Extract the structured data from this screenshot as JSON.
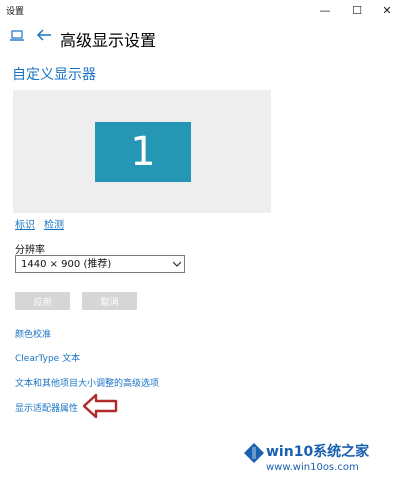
{
  "window": {
    "title": "设置",
    "minimize": "—",
    "maximize": "☐",
    "close": "✕"
  },
  "header": {
    "title": "高级显示设置"
  },
  "display": {
    "section_title": "自定义显示器",
    "monitor_number": "1",
    "identify_link": "标识",
    "detect_link": "检测"
  },
  "resolution": {
    "label": "分辨率",
    "value": "1440 × 900 (推荐)"
  },
  "buttons": {
    "apply": "应用",
    "cancel": "取消"
  },
  "links": [
    "颜色校准",
    "ClearType 文本",
    "文本和其他项目大小调整的高级选项",
    "显示适配器属性"
  ],
  "watermark": {
    "line1": "win10系统之家",
    "line2": "www.win10os.com"
  },
  "colors": {
    "accent": "#1a73c4",
    "monitor_tile": "#2596b4",
    "arrow": "#b02a2a"
  }
}
